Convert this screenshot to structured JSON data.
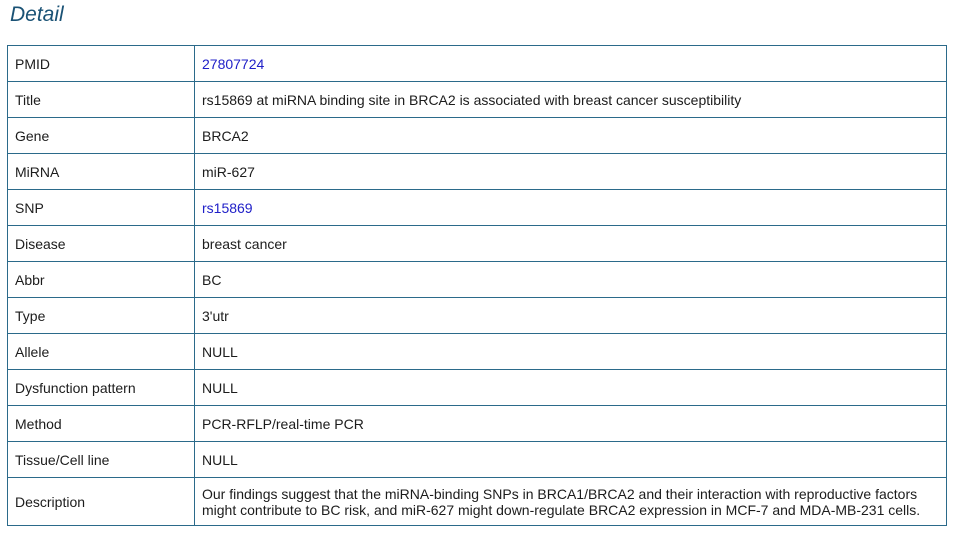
{
  "page": {
    "title": "Detail"
  },
  "colors": {
    "title": "#1a5275",
    "border": "#2b6a8a",
    "link": "#2020c8",
    "text": "#1c1c1c"
  },
  "rows": [
    {
      "key": "PMID",
      "value": "27807724",
      "link": true
    },
    {
      "key": "Title",
      "value": "rs15869 at miRNA binding site in BRCA2 is associated with breast cancer susceptibility",
      "link": false
    },
    {
      "key": "Gene",
      "value": "BRCA2",
      "link": false
    },
    {
      "key": "MiRNA",
      "value": "miR-627",
      "link": false
    },
    {
      "key": "SNP",
      "value": "rs15869",
      "link": true
    },
    {
      "key": "Disease",
      "value": "breast cancer",
      "link": false
    },
    {
      "key": "Abbr",
      "value": "BC",
      "link": false
    },
    {
      "key": "Type",
      "value": "3'utr",
      "link": false
    },
    {
      "key": "Allele",
      "value": "NULL",
      "link": false
    },
    {
      "key": "Dysfunction pattern",
      "value": "NULL",
      "link": false
    },
    {
      "key": "Method",
      "value": "PCR-RFLP/real-time PCR",
      "link": false
    },
    {
      "key": "Tissue/Cell line",
      "value": "NULL",
      "link": false
    },
    {
      "key": "Description",
      "value": "Our findings suggest that the miRNA-binding SNPs in BRCA1/BRCA2 and their interaction with reproductive factors might contribute to BC risk, and miR-627 might down-regulate BRCA2 expression in MCF-7 and MDA-MB-231 cells.",
      "link": false
    }
  ]
}
